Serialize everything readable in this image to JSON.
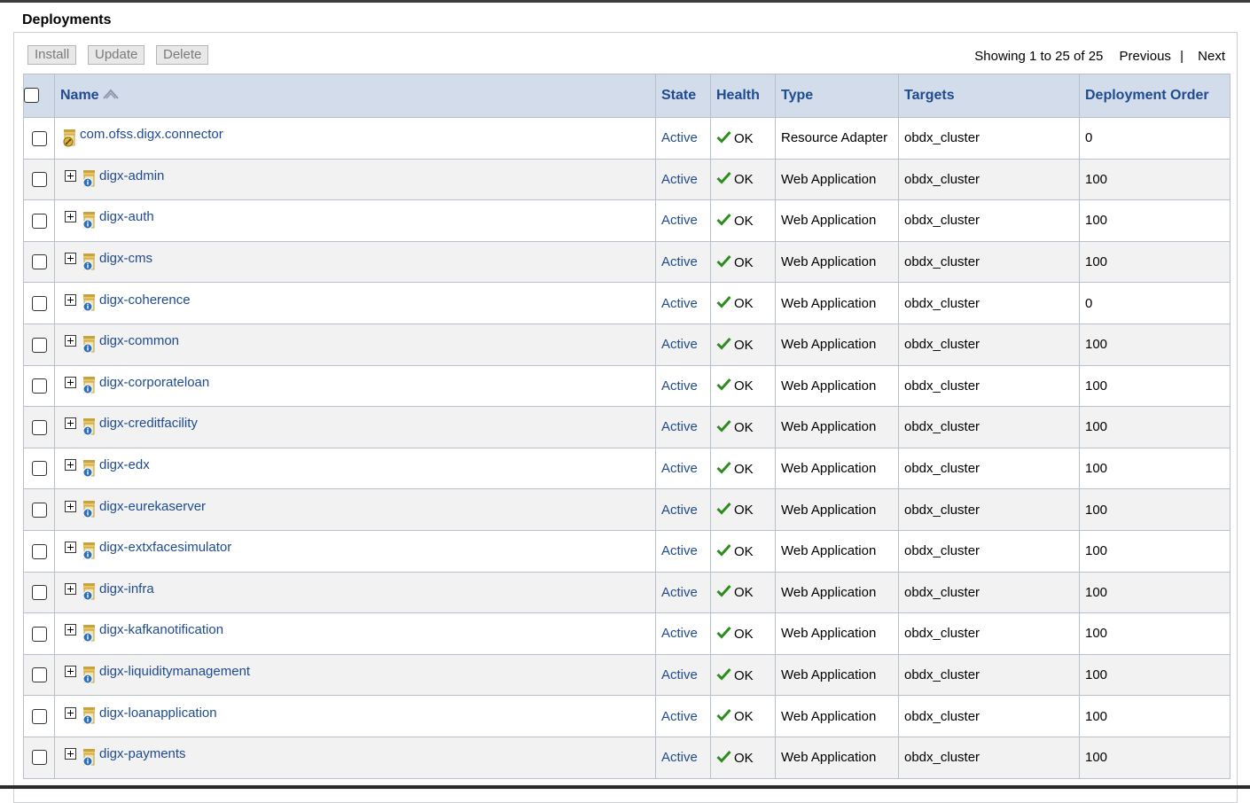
{
  "section_title": "Deployments",
  "toolbar": {
    "install_label": "Install",
    "update_label": "Update",
    "delete_label": "Delete"
  },
  "pager": {
    "showing": "Showing 1 to 25 of 25",
    "previous": "Previous",
    "separator": "|",
    "next": "Next"
  },
  "columns": {
    "name": "Name",
    "state": "State",
    "health": "Health",
    "type": "Type",
    "targets": "Targets",
    "deployment_order": "Deployment Order"
  },
  "rows": [
    {
      "name": "com.ofss.digx.connector",
      "state": "Active",
      "health": "OK",
      "type": "Resource Adapter",
      "targets": "obdx_cluster",
      "order": "0",
      "expandable": false,
      "icon": "resource-adapter-icon"
    },
    {
      "name": "digx-admin",
      "state": "Active",
      "health": "OK",
      "type": "Web Application",
      "targets": "obdx_cluster",
      "order": "100",
      "expandable": true,
      "icon": "web-app-jar-icon"
    },
    {
      "name": "digx-auth",
      "state": "Active",
      "health": "OK",
      "type": "Web Application",
      "targets": "obdx_cluster",
      "order": "100",
      "expandable": true,
      "icon": "web-app-jar-icon"
    },
    {
      "name": "digx-cms",
      "state": "Active",
      "health": "OK",
      "type": "Web Application",
      "targets": "obdx_cluster",
      "order": "100",
      "expandable": true,
      "icon": "web-app-jar-icon"
    },
    {
      "name": "digx-coherence",
      "state": "Active",
      "health": "OK",
      "type": "Web Application",
      "targets": "obdx_cluster",
      "order": "0",
      "expandable": true,
      "icon": "web-app-jar-icon"
    },
    {
      "name": "digx-common",
      "state": "Active",
      "health": "OK",
      "type": "Web Application",
      "targets": "obdx_cluster",
      "order": "100",
      "expandable": true,
      "icon": "web-app-jar-icon"
    },
    {
      "name": "digx-corporateloan",
      "state": "Active",
      "health": "OK",
      "type": "Web Application",
      "targets": "obdx_cluster",
      "order": "100",
      "expandable": true,
      "icon": "web-app-jar-icon"
    },
    {
      "name": "digx-creditfacility",
      "state": "Active",
      "health": "OK",
      "type": "Web Application",
      "targets": "obdx_cluster",
      "order": "100",
      "expandable": true,
      "icon": "web-app-jar-icon"
    },
    {
      "name": "digx-edx",
      "state": "Active",
      "health": "OK",
      "type": "Web Application",
      "targets": "obdx_cluster",
      "order": "100",
      "expandable": true,
      "icon": "web-app-jar-icon"
    },
    {
      "name": "digx-eurekaserver",
      "state": "Active",
      "health": "OK",
      "type": "Web Application",
      "targets": "obdx_cluster",
      "order": "100",
      "expandable": true,
      "icon": "web-app-jar-icon"
    },
    {
      "name": "digx-extxfacesimulator",
      "state": "Active",
      "health": "OK",
      "type": "Web Application",
      "targets": "obdx_cluster",
      "order": "100",
      "expandable": true,
      "icon": "web-app-jar-icon"
    },
    {
      "name": "digx-infra",
      "state": "Active",
      "health": "OK",
      "type": "Web Application",
      "targets": "obdx_cluster",
      "order": "100",
      "expandable": true,
      "icon": "web-app-jar-icon"
    },
    {
      "name": "digx-kafkanotification",
      "state": "Active",
      "health": "OK",
      "type": "Web Application",
      "targets": "obdx_cluster",
      "order": "100",
      "expandable": true,
      "icon": "web-app-jar-icon"
    },
    {
      "name": "digx-liquiditymanagement",
      "state": "Active",
      "health": "OK",
      "type": "Web Application",
      "targets": "obdx_cluster",
      "order": "100",
      "expandable": true,
      "icon": "web-app-jar-icon"
    },
    {
      "name": "digx-loanapplication",
      "state": "Active",
      "health": "OK",
      "type": "Web Application",
      "targets": "obdx_cluster",
      "order": "100",
      "expandable": true,
      "icon": "web-app-jar-icon"
    },
    {
      "name": "digx-payments",
      "state": "Active",
      "health": "OK",
      "type": "Web Application",
      "targets": "obdx_cluster",
      "order": "100",
      "expandable": true,
      "icon": "web-app-jar-icon"
    }
  ],
  "colors": {
    "link": "#1f4b8e",
    "header_bg": "#d3dcea",
    "ok_green": "#2e8b1e"
  }
}
